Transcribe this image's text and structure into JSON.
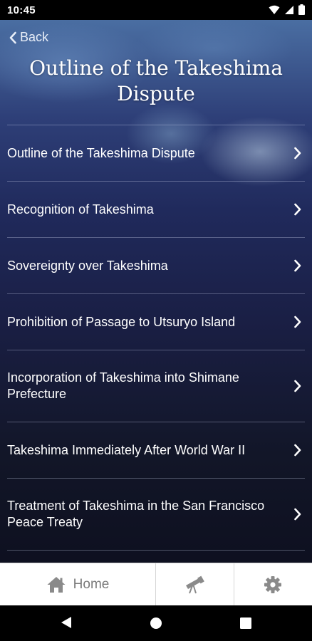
{
  "status": {
    "time": "10:45"
  },
  "header": {
    "back_label": "Back",
    "title": "Outline of the Takeshima Dispute"
  },
  "menu": {
    "items": [
      {
        "label": "Outline of the Takeshima Dispute"
      },
      {
        "label": "Recognition of Takeshima"
      },
      {
        "label": "Sovereignty over Takeshima"
      },
      {
        "label": "Prohibition of Passage to Utsuryo Island"
      },
      {
        "label": "Incorporation of Takeshima into Shimane Prefecture"
      },
      {
        "label": "Takeshima Immediately After World War II"
      },
      {
        "label": "Treatment of Takeshima in the San Francisco Peace Treaty"
      }
    ]
  },
  "bottom_nav": {
    "home_label": "Home",
    "home_icon": "home-icon",
    "explore_icon": "telescope-icon",
    "settings_icon": "gear-icon"
  },
  "colors": {
    "bar_background": "#ffffff",
    "icon_gray": "#8a8a8a",
    "text_white": "#ffffff"
  }
}
